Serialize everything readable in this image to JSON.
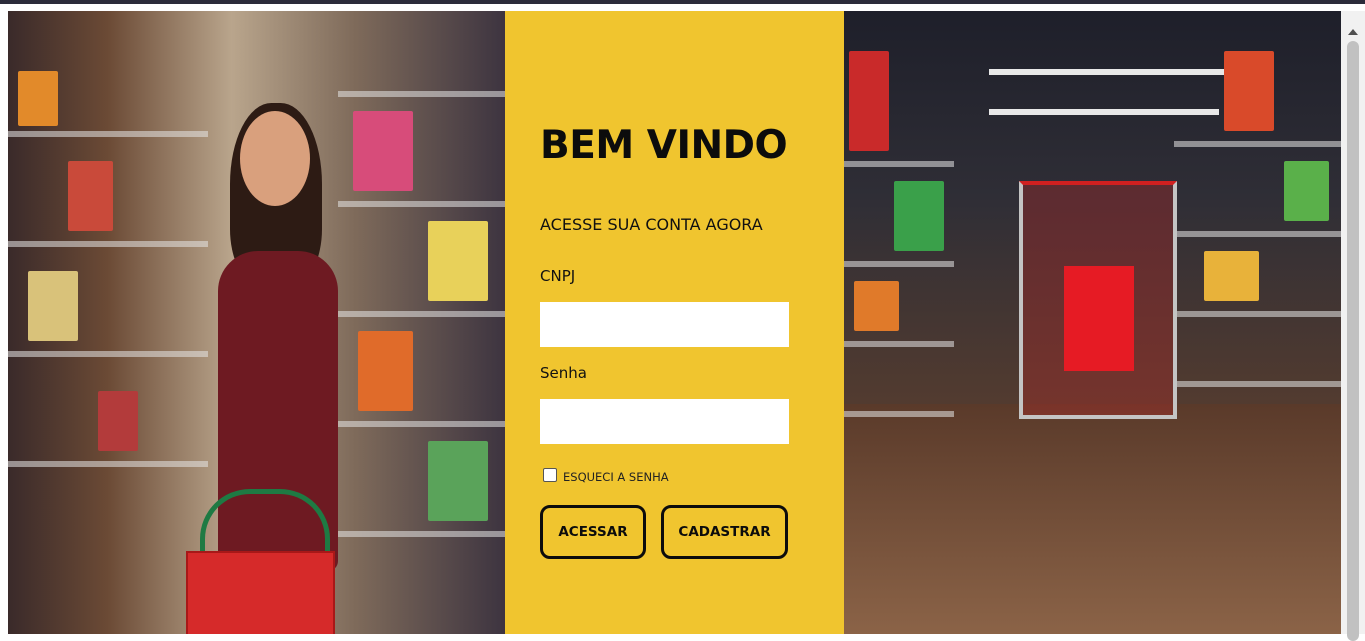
{
  "login": {
    "title": "BEM VINDO",
    "subtitle": "ACESSE SUA CONTA AGORA",
    "cnpj_label": "CNPJ",
    "cnpj_value": "",
    "password_label": "Senha",
    "password_value": "",
    "forgot_label": "ESQUECI A SENHA",
    "forgot_checked": false,
    "access_button": "ACESSAR",
    "register_button": "CADASTRAR"
  },
  "colors": {
    "panel": "#f0c52f",
    "text": "#0c0c0c"
  },
  "images": {
    "left": "woman-shopping-supermarket-aisle-photo",
    "right": "shopping-cart-supermarket-aisle-photo"
  }
}
